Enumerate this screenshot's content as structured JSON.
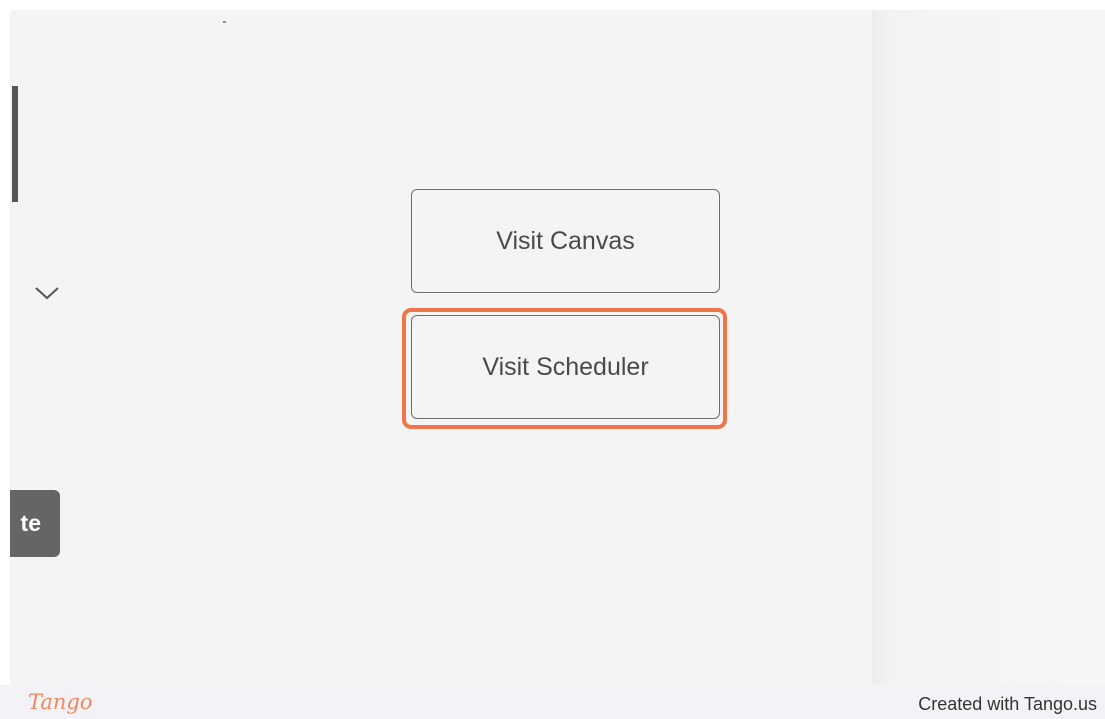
{
  "buttons": {
    "visit_canvas": "Visit Canvas",
    "visit_scheduler": "Visit Scheduler",
    "partial_left_label": "te"
  },
  "footer": {
    "logo_text": "Tango",
    "credit": "Created with Tango.us"
  },
  "icons": {
    "dropdown": "chevron-down-icon",
    "scroll": "scrollbar"
  },
  "colors": {
    "highlight": "#f0764a",
    "background": "#f4f4f4",
    "dark_button": "#656565",
    "tango_brand": "#f0885c"
  }
}
